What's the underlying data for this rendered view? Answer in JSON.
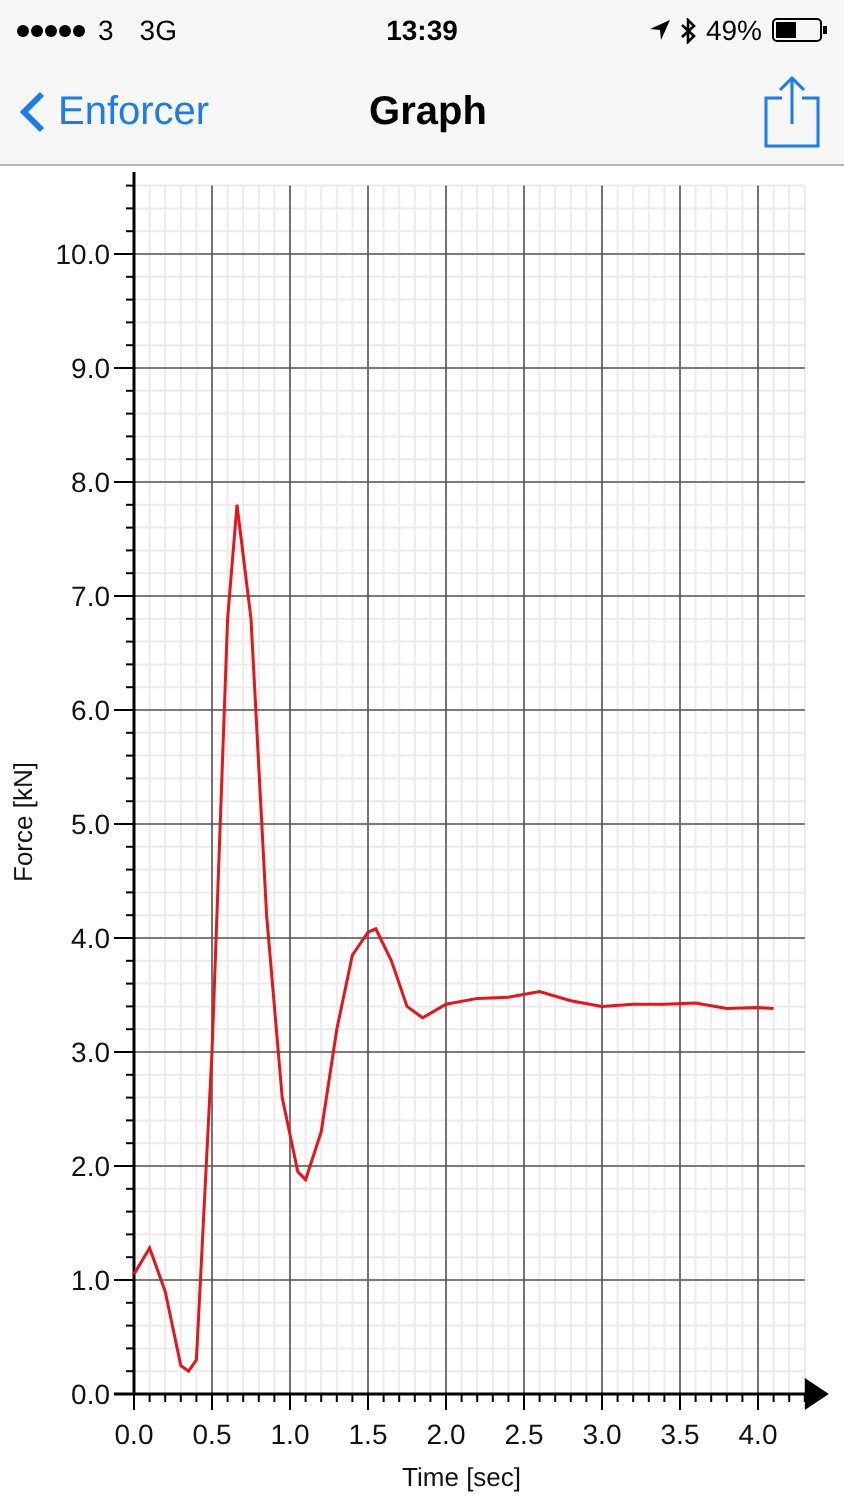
{
  "status_bar": {
    "carrier": "3",
    "network": "3G",
    "time": "13:39",
    "battery": "49%"
  },
  "nav_bar": {
    "back": "Enforcer",
    "title": "Graph"
  },
  "chart": {
    "chart_data": {
      "type": "line",
      "grid": true,
      "xlabel": "Time [sec]",
      "ylabel": "Force [kN]",
      "xlim": [
        0,
        4.3
      ],
      "ylim": [
        0,
        10.6
      ],
      "xticks": [
        {
          "value": 0,
          "label": "0.0"
        },
        {
          "value": 0.5,
          "label": "0.5"
        },
        {
          "value": 1,
          "label": "1.0"
        },
        {
          "value": 1.5,
          "label": "1.5"
        },
        {
          "value": 2,
          "label": "2.0"
        },
        {
          "value": 2.5,
          "label": "2.5"
        },
        {
          "value": 3,
          "label": "3.0"
        },
        {
          "value": 3.5,
          "label": "3.5"
        },
        {
          "value": 4,
          "label": "4.0"
        }
      ],
      "yticks": [
        {
          "value": 0,
          "label": "0.0"
        },
        {
          "value": 1,
          "label": "1.0"
        },
        {
          "value": 2,
          "label": "2.0"
        },
        {
          "value": 3,
          "label": "3.0"
        },
        {
          "value": 4,
          "label": "4.0"
        },
        {
          "value": 5,
          "label": "5.0"
        },
        {
          "value": 6,
          "label": "6.0"
        },
        {
          "value": 7,
          "label": "7.0"
        },
        {
          "value": 8,
          "label": "8.0"
        },
        {
          "value": 9,
          "label": "9.0"
        },
        {
          "value": 10,
          "label": "10.0"
        }
      ],
      "x": [
        0,
        0.1,
        0.2,
        0.3,
        0.35,
        0.4,
        0.5,
        0.6,
        0.66,
        0.75,
        0.85,
        0.95,
        1.05,
        1.1,
        1.2,
        1.3,
        1.4,
        1.5,
        1.55,
        1.65,
        1.75,
        1.85,
        2.0,
        2.2,
        2.4,
        2.6,
        2.8,
        3.0,
        3.2,
        3.4,
        3.6,
        3.8,
        4.0,
        4.1
      ],
      "series": [
        {
          "color": "#e8141b",
          "values": [
            1.05,
            1.28,
            0.9,
            0.25,
            0.2,
            0.3,
            3.0,
            6.8,
            7.8,
            6.8,
            4.2,
            2.6,
            1.95,
            1.88,
            2.3,
            3.2,
            3.85,
            4.05,
            4.08,
            3.8,
            3.4,
            3.3,
            3.42,
            3.47,
            3.48,
            3.53,
            3.45,
            3.4,
            3.42,
            3.42,
            3.43,
            3.38,
            3.39,
            3.38
          ]
        }
      ]
    }
  }
}
